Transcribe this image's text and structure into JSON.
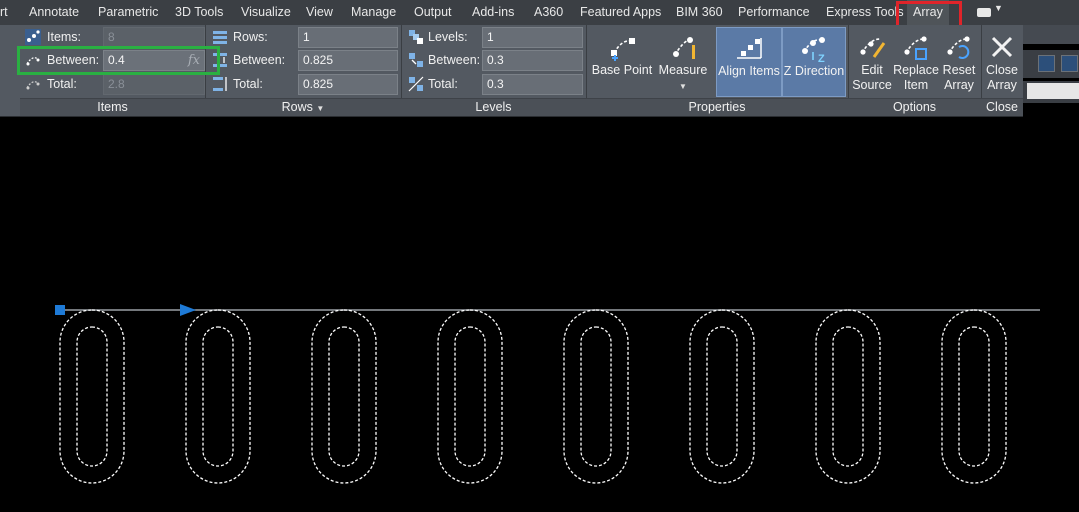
{
  "tabs": [
    {
      "label": "rt",
      "active": false
    },
    {
      "label": "Annotate",
      "active": false
    },
    {
      "label": "Parametric",
      "active": false
    },
    {
      "label": "3D Tools",
      "active": false
    },
    {
      "label": "Visualize",
      "active": false
    },
    {
      "label": "View",
      "active": false
    },
    {
      "label": "Manage",
      "active": false
    },
    {
      "label": "Output",
      "active": false
    },
    {
      "label": "Add-ins",
      "active": false
    },
    {
      "label": "A360",
      "active": false
    },
    {
      "label": "Featured Apps",
      "active": false
    },
    {
      "label": "BIM 360",
      "active": false
    },
    {
      "label": "Performance",
      "active": false
    },
    {
      "label": "Express Tools",
      "active": false
    },
    {
      "label": "Array",
      "active": true
    }
  ],
  "panels": {
    "items": {
      "title": "Items",
      "items_label": "Items:",
      "items_value": "8",
      "between_label": "Between:",
      "between_value": "0.4",
      "total_label": "Total:",
      "total_value": "2.8",
      "fx_symbol": "fx"
    },
    "rows": {
      "title": "Rows",
      "rows_label": "Rows:",
      "rows_value": "1",
      "between_label": "Between:",
      "between_value": "0.825",
      "total_label": "Total:",
      "total_value": "0.825"
    },
    "levels": {
      "title": "Levels",
      "levels_label": "Levels:",
      "levels_value": "1",
      "between_label": "Between:",
      "between_value": "0.3",
      "total_label": "Total:",
      "total_value": "0.3"
    },
    "properties": {
      "title": "Properties",
      "base_point": "Base Point",
      "measure": "Measure",
      "align_items": "Align Items",
      "z_direction": "Z Direction"
    },
    "options": {
      "title": "Options",
      "edit_source_1": "Edit",
      "edit_source_2": "Source",
      "replace_item_1": "Replace",
      "replace_item_2": "Item",
      "reset_array_1": "Reset",
      "reset_array_2": "Array"
    },
    "close": {
      "title": "Close",
      "close_array_1": "Close",
      "close_array_2": "Array"
    }
  },
  "colors": {
    "accent_blue": "#1e7ad6",
    "selection_red": "#e0242a",
    "selection_green": "#2ab042"
  },
  "drawing": {
    "array_item_count": 8,
    "item_shape": "slot-dashed"
  }
}
